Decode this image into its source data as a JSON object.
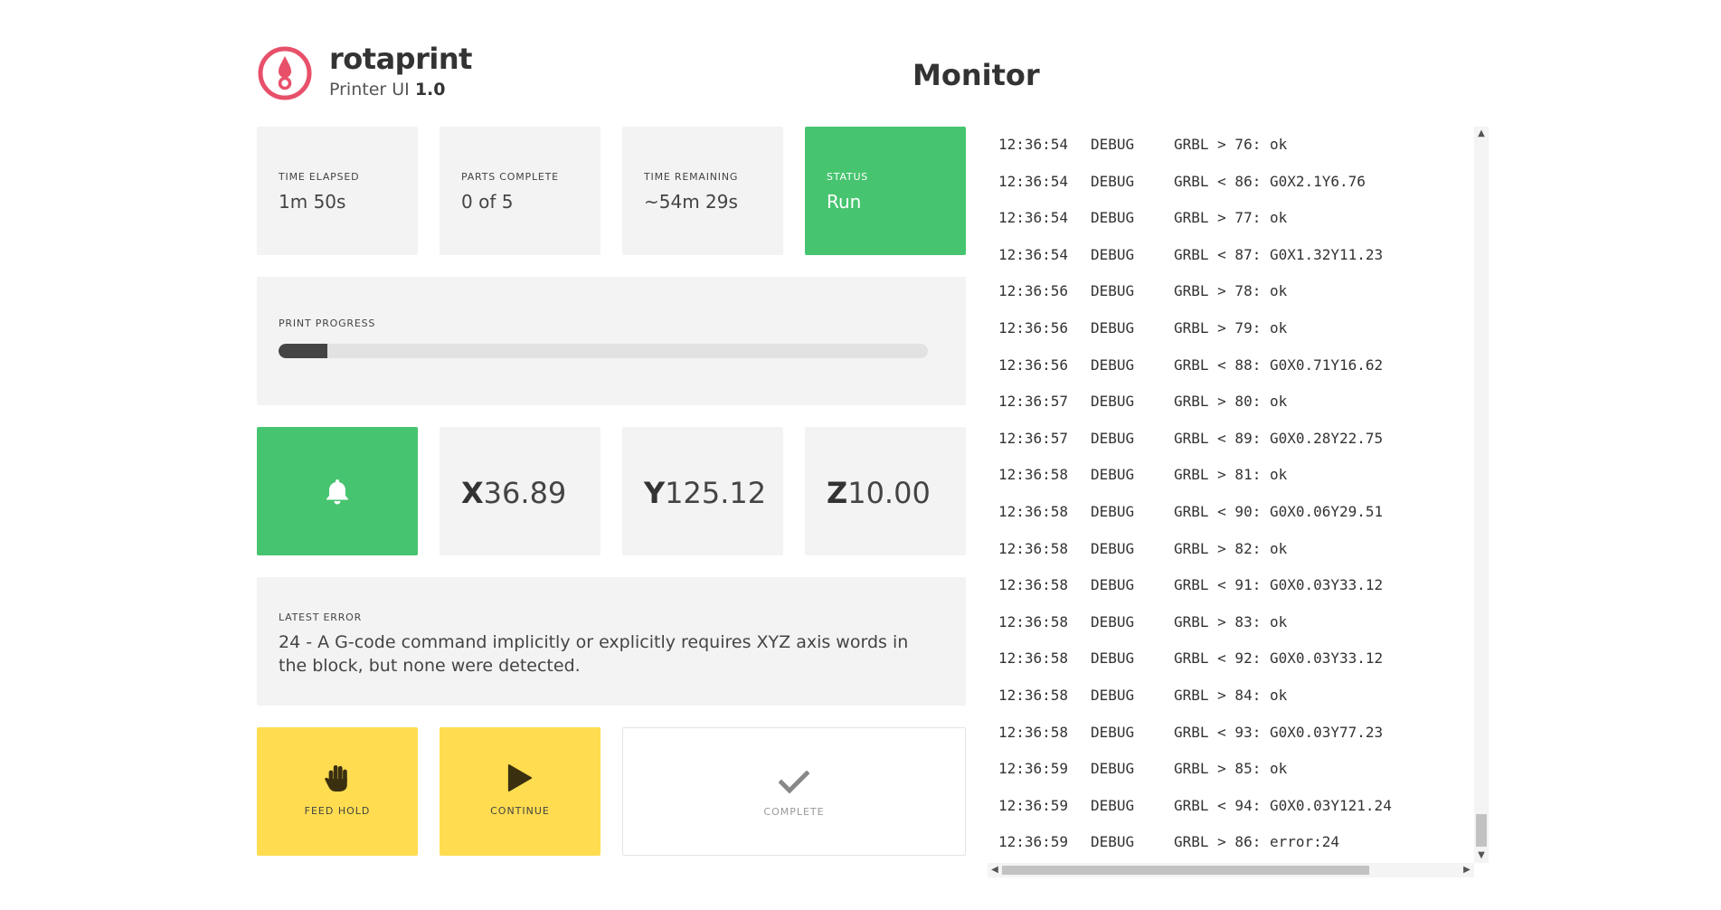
{
  "header": {
    "brand_name": "rotaprint",
    "subtitle_prefix": "Printer UI",
    "version": "1.0",
    "page_title": "Monitor",
    "logo_icon": "droplet-in-circle-icon",
    "brand_color": "#e8506a"
  },
  "stats": [
    {
      "label": "TIME ELAPSED",
      "value": "1m 50s"
    },
    {
      "label": "PARTS COMPLETE",
      "value": "0 of 5"
    },
    {
      "label": "TIME REMAINING",
      "value": "~54m 29s"
    },
    {
      "label": "STATUS",
      "value": "Run"
    }
  ],
  "progress": {
    "label": "PRINT PROGRESS",
    "percent": 7.5
  },
  "alarm": {
    "icon": "bell-icon"
  },
  "coords": {
    "x": {
      "axis": "X",
      "value": "36.89"
    },
    "y": {
      "axis": "Y",
      "value": "125.12"
    },
    "z": {
      "axis": "Z",
      "value": "10.00"
    }
  },
  "error": {
    "label": "LATEST ERROR",
    "text": "24 - A G-code command implicitly or explicitly requires XYZ axis words in the block, but none were detected."
  },
  "buttons": {
    "feed_hold": {
      "label": "FEED HOLD",
      "icon": "hand-icon"
    },
    "continue": {
      "label": "CONTINUE",
      "icon": "play-icon"
    },
    "complete": {
      "label": "COMPLETE",
      "icon": "checkmark-icon"
    }
  },
  "colors": {
    "green": "#47c46f",
    "yellow": "#ffdc50",
    "card_grey": "#f3f3f3"
  },
  "log": [
    {
      "time": "12:36:54",
      "level": "DEBUG",
      "msg": "GRBL > 76: ok"
    },
    {
      "time": "12:36:54",
      "level": "DEBUG",
      "msg": "GRBL < 86: G0X2.1Y6.76"
    },
    {
      "time": "12:36:54",
      "level": "DEBUG",
      "msg": "GRBL > 77: ok"
    },
    {
      "time": "12:36:54",
      "level": "DEBUG",
      "msg": "GRBL < 87: G0X1.32Y11.23"
    },
    {
      "time": "12:36:56",
      "level": "DEBUG",
      "msg": "GRBL > 78: ok"
    },
    {
      "time": "12:36:56",
      "level": "DEBUG",
      "msg": "GRBL > 79: ok"
    },
    {
      "time": "12:36:56",
      "level": "DEBUG",
      "msg": "GRBL < 88: G0X0.71Y16.62"
    },
    {
      "time": "12:36:57",
      "level": "DEBUG",
      "msg": "GRBL > 80: ok"
    },
    {
      "time": "12:36:57",
      "level": "DEBUG",
      "msg": "GRBL < 89: G0X0.28Y22.75"
    },
    {
      "time": "12:36:58",
      "level": "DEBUG",
      "msg": "GRBL > 81: ok"
    },
    {
      "time": "12:36:58",
      "level": "DEBUG",
      "msg": "GRBL < 90: G0X0.06Y29.51"
    },
    {
      "time": "12:36:58",
      "level": "DEBUG",
      "msg": "GRBL > 82: ok"
    },
    {
      "time": "12:36:58",
      "level": "DEBUG",
      "msg": "GRBL < 91: G0X0.03Y33.12"
    },
    {
      "time": "12:36:58",
      "level": "DEBUG",
      "msg": "GRBL > 83: ok"
    },
    {
      "time": "12:36:58",
      "level": "DEBUG",
      "msg": "GRBL < 92: G0X0.03Y33.12"
    },
    {
      "time": "12:36:58",
      "level": "DEBUG",
      "msg": "GRBL > 84: ok"
    },
    {
      "time": "12:36:58",
      "level": "DEBUG",
      "msg": "GRBL < 93: G0X0.03Y77.23"
    },
    {
      "time": "12:36:59",
      "level": "DEBUG",
      "msg": "GRBL > 85: ok"
    },
    {
      "time": "12:36:59",
      "level": "DEBUG",
      "msg": "GRBL < 94: G0X0.03Y121.24"
    },
    {
      "time": "12:36:59",
      "level": "DEBUG",
      "msg": "GRBL > 86: error:24"
    }
  ]
}
